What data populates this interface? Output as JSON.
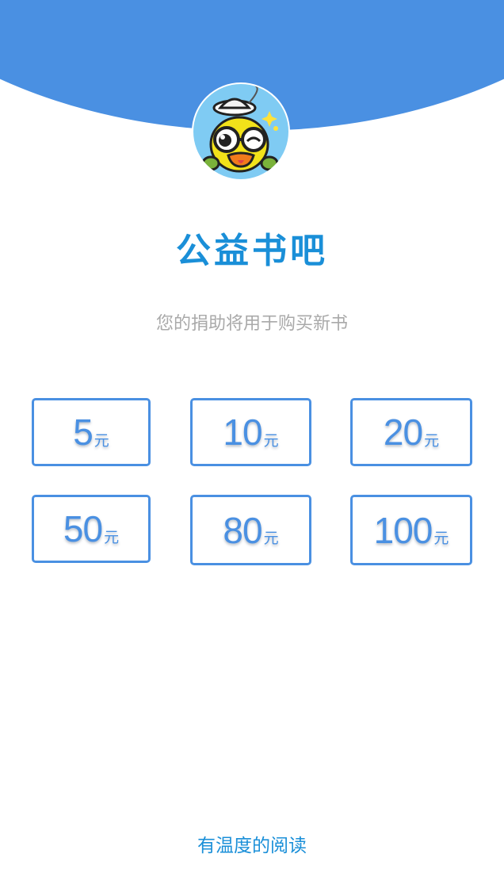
{
  "app": {
    "title": "公益书吧",
    "subtitle": "您的捐助将用于购买新书",
    "footer_slogan": "有温度的阅读"
  },
  "avatar": {
    "icon": "cartoon-duck-mascot-icon"
  },
  "amounts": [
    {
      "value": "5",
      "unit": "元"
    },
    {
      "value": "10",
      "unit": "元"
    },
    {
      "value": "20",
      "unit": "元"
    },
    {
      "value": "50",
      "unit": "元"
    },
    {
      "value": "80",
      "unit": "元"
    },
    {
      "value": "100",
      "unit": "元"
    }
  ],
  "colors": {
    "brand_blue": "#4a90e2",
    "title_blue": "#1a8fd8",
    "avatar_bg": "#7fcbf3",
    "subtitle_gray": "#a9a9a9"
  }
}
